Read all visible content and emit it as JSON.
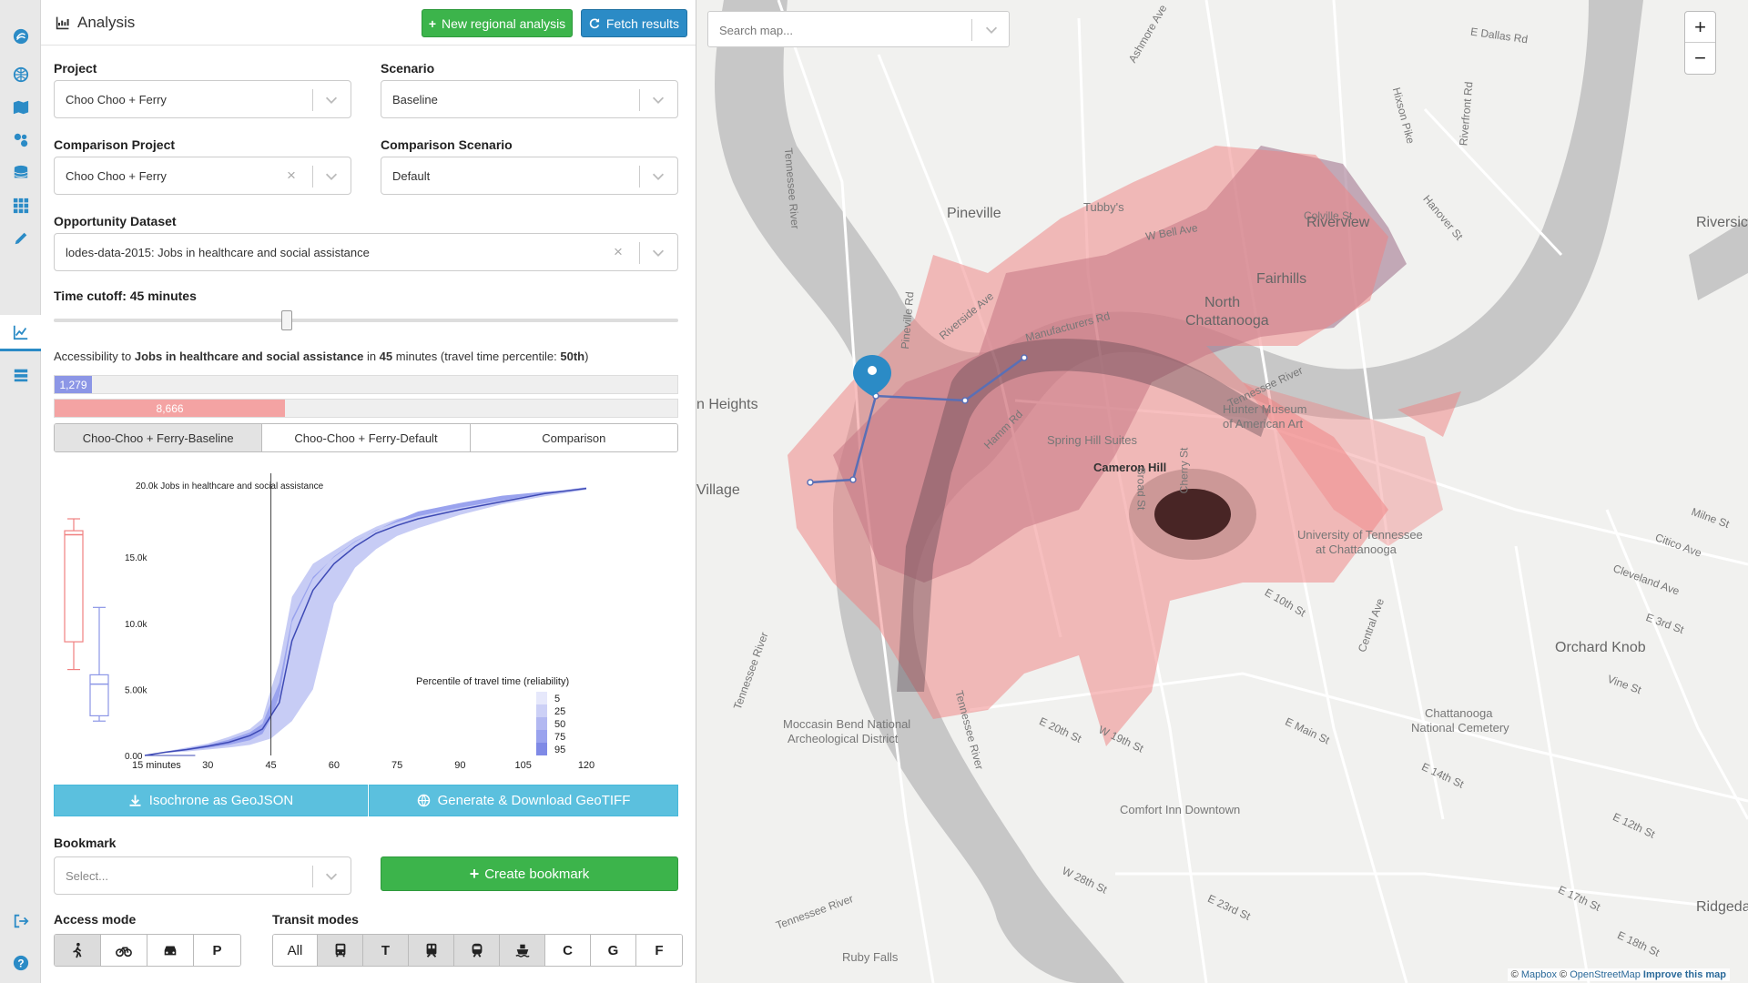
{
  "panel": {
    "title": "Analysis",
    "new_regional_label": "New regional analysis",
    "fetch_label": "Fetch results"
  },
  "form": {
    "project_label": "Project",
    "project_value": "Choo Choo + Ferry",
    "scenario_label": "Scenario",
    "scenario_value": "Baseline",
    "comparison_project_label": "Comparison Project",
    "comparison_project_value": "Choo Choo + Ferry",
    "comparison_scenario_label": "Comparison Scenario",
    "comparison_scenario_value": "Default",
    "opportunity_label": "Opportunity Dataset",
    "opportunity_value": "lodes-data-2015: Jobs in healthcare and social assistance",
    "time_cutoff_label": "Time cutoff: 45 minutes",
    "time_cutoff_minutes": 45
  },
  "accessibility": {
    "prefix": "Accessibility to ",
    "dataset": "Jobs in healthcare and social assistance",
    "mid": " in ",
    "minutes": "45",
    "suffix": " minutes (travel time percentile: ",
    "percentile": "50th",
    "end": ")",
    "bar1_value": "1,279",
    "bar1_fraction": 0.06,
    "bar2_value": "8,666",
    "bar2_fraction": 0.37
  },
  "compare_tabs": [
    "Choo-Choo + Ferry-Baseline",
    "Choo-Choo + Ferry-Default",
    "Comparison"
  ],
  "chart_data": {
    "type": "area",
    "title": "20.0k Jobs in healthcare and social assistance",
    "y_ticks": [
      "15.0k",
      "10.0k",
      "5.00k",
      "0.00"
    ],
    "y_tick_values": [
      15000,
      10000,
      5000,
      0
    ],
    "x_ticks": [
      "15 minutes",
      "30",
      "45",
      "60",
      "75",
      "90",
      "105",
      "120"
    ],
    "x_tick_values": [
      15,
      30,
      45,
      60,
      75,
      90,
      105,
      120
    ],
    "xlim": [
      0,
      120
    ],
    "ylim": [
      0,
      21000
    ],
    "cutoff_minutes": 45,
    "legend_title": "Percentile of travel time (reliability)",
    "legend_entries": [
      "5",
      "25",
      "50",
      "75",
      "95"
    ],
    "series": [
      {
        "name": "5",
        "x": [
          15,
          20,
          25,
          30,
          35,
          40,
          43,
          45,
          47,
          50,
          55,
          60,
          65,
          70,
          75,
          80,
          90,
          100,
          110,
          120
        ],
        "values": [
          0,
          300,
          600,
          900,
          1400,
          2000,
          2800,
          5000,
          7000,
          12000,
          14500,
          15500,
          16500,
          17300,
          17900,
          18300,
          18900,
          19400,
          19900,
          20300
        ]
      },
      {
        "name": "50",
        "x": [
          15,
          20,
          25,
          30,
          35,
          40,
          43,
          45,
          47,
          50,
          55,
          60,
          65,
          70,
          75,
          80,
          90,
          100,
          110,
          120
        ],
        "values": [
          0,
          250,
          450,
          700,
          1000,
          1500,
          2000,
          3000,
          4000,
          8666,
          12500,
          14500,
          15800,
          16800,
          17400,
          17900,
          18600,
          19200,
          19800,
          20200
        ]
      },
      {
        "name": "95",
        "x": [
          15,
          20,
          25,
          30,
          35,
          40,
          45,
          50,
          55,
          60,
          65,
          70,
          75,
          80,
          90,
          100,
          110,
          120
        ],
        "values": [
          0,
          200,
          300,
          450,
          600,
          800,
          1279,
          2600,
          5000,
          11500,
          14200,
          15600,
          16600,
          17200,
          18200,
          19000,
          19600,
          20100
        ]
      }
    ],
    "boxplots": [
      {
        "name": "baseline",
        "color": "#f08080",
        "min": 6500,
        "q1": 8600,
        "median": 16700,
        "q3": 17000,
        "max": 17900
      },
      {
        "name": "comparison",
        "color": "#8c96e6",
        "min": 2600,
        "q1": 3000,
        "median": 5400,
        "q3": 6100,
        "max": 11200
      }
    ]
  },
  "downloads": {
    "isochrone_label": "Isochrone as GeoJSON",
    "geotiff_label": "Generate & Download GeoTIFF"
  },
  "bookmark": {
    "label": "Bookmark",
    "placeholder": "Select...",
    "create_label": "Create bookmark"
  },
  "access_modes": {
    "label": "Access mode",
    "items": [
      "walk",
      "bike",
      "car",
      "P"
    ]
  },
  "transit_modes": {
    "label": "Transit modes",
    "items": [
      "All",
      "bus",
      "T",
      "rail",
      "subway",
      "ferry",
      "C",
      "G",
      "F"
    ]
  },
  "map": {
    "search_placeholder": "Search map...",
    "zoom_in": "+",
    "zoom_out": "−",
    "attribution_mapbox": "Mapbox",
    "attribution_osm": "OpenStreetMap",
    "attribution_improve": "Improve this map",
    "labels": {
      "pineville": "Pineville",
      "tubbys": "Tubby's",
      "north_chatt": "North",
      "north_chatt2": "Chattanooga",
      "riverview": "Riverview",
      "fairhills": "Fairhills",
      "riversic": "Riversic",
      "heights": "n Heights",
      "village": "Village",
      "hunter": "Hunter Museum",
      "hunter2": "of American Art",
      "spring_hill": "Spring Hill Suites",
      "cameron_hill": "Cameron Hill",
      "utc": "University of Tennessee",
      "utc2": "at Chattanooga",
      "orchard_knob": "Orchard Knob",
      "moccasin": "Moccasin Bend National",
      "moccasin2": "Archeological District",
      "cemetery": "Chattanooga",
      "cemetery2": "National Cemetery",
      "comfort_inn": "Comfort Inn Downtown",
      "ruby_falls": "Ruby Falls",
      "ridgedale": "Ridgedal",
      "colville": "Colville St",
      "manufacturers": "Manufacturers Rd",
      "riverside_ave": "Riverside Ave",
      "pineville_rd": "Pineville Rd",
      "hamm_rd": "Hamm Rd",
      "broad_st": "Broad St",
      "cherry_st": "Cherry St",
      "e_main": "E Main St",
      "e_dallas": "E Dallas Rd",
      "tn_river1": "Tennessee River",
      "tn_river2": "Tennessee River",
      "tn_river3": "Tennessee River",
      "tn_river4": "Tennessee River",
      "tn_river5": "Tennessee River",
      "e20th": "E 20th St",
      "w19th": "W 19th St",
      "e23rd": "E 23rd St",
      "w28th": "W 28th St",
      "e14th": "E 14th St",
      "e17th": "E 17th St",
      "e18th": "E 18th St",
      "e12th": "E 12th St",
      "vine": "Vine St",
      "e3rd": "E 3rd St",
      "cleveland": "Cleveland Ave",
      "milne": "Milne St",
      "citico": "Citico Ave",
      "e10th": "E 10th St",
      "w_bell": "W Bell Ave",
      "ashmore": "Ashmore Ave",
      "hixson": "Hixson Pike",
      "hanover": "Hanover St",
      "riverfront": "Riverfront Rd",
      "central": "Central Ave",
      "orchard": "Orchard Knob"
    }
  },
  "colors": {
    "accent_blue": "#2b8bc6",
    "green": "#3cb44b",
    "teal": "#5bc0de",
    "baseline_red": "#f08080",
    "comparison_blue": "#8c96e6"
  }
}
